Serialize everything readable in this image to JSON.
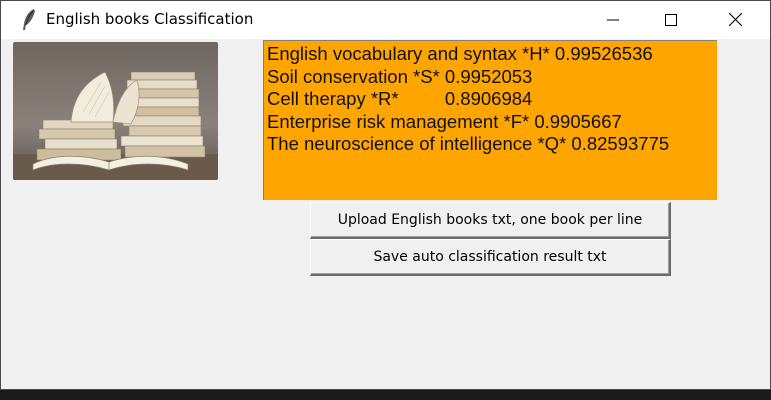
{
  "window": {
    "title": "English books Classification",
    "icons": {
      "app": "feather-icon",
      "minimize": "minimize-icon",
      "maximize": "maximize-icon",
      "close": "close-icon"
    }
  },
  "image": {
    "name": "stacked-books-image"
  },
  "results": {
    "background_color": "#ffa500",
    "lines": [
      "English vocabulary and syntax *H* 0.99526536",
      "Soil conservation *S* 0.9952053",
      "Cell therapy *R*         0.8906984",
      "Enterprise risk management *F* 0.9905667",
      "The neuroscience of intelligence *Q* 0.82593775"
    ]
  },
  "buttons": {
    "upload_label": "Upload English books txt, one book per line",
    "save_label": "Save auto classification result txt"
  }
}
